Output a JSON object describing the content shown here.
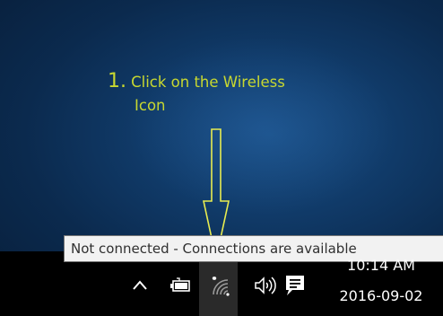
{
  "annotation": {
    "step_number": "1.",
    "line1": "Click on the Wireless",
    "line2": "Icon",
    "color": "#c8d830"
  },
  "tooltip": {
    "text": "Not connected - Connections are available"
  },
  "tray": {
    "icons": [
      "chevron-up-icon",
      "battery-icon",
      "wireless-network-icon",
      "volume-icon",
      "action-center-icon"
    ],
    "wireless_status": "Not connected"
  },
  "clock": {
    "time": "10:14 AM",
    "date": "2016-09-02"
  },
  "colors": {
    "desktop": "#0b2a4e",
    "taskbar": "#000000",
    "tooltip_bg": "#f2f2f2",
    "arrow": "#e8ec50"
  }
}
